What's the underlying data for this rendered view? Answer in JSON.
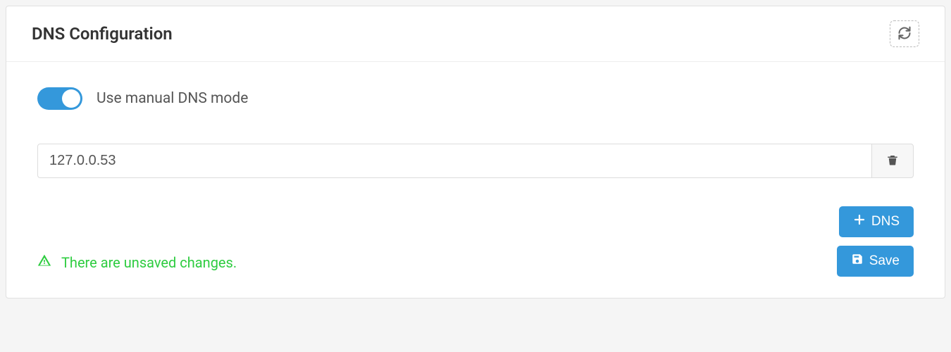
{
  "header": {
    "title": "DNS Configuration"
  },
  "toggle": {
    "label": "Use manual DNS mode",
    "enabled": true
  },
  "dns_entries": [
    {
      "value": "127.0.0.53"
    }
  ],
  "status": {
    "message": "There are unsaved changes."
  },
  "actions": {
    "add_label": "DNS",
    "save_label": "Save"
  },
  "colors": {
    "primary": "#3498db",
    "success": "#2ecc40"
  }
}
